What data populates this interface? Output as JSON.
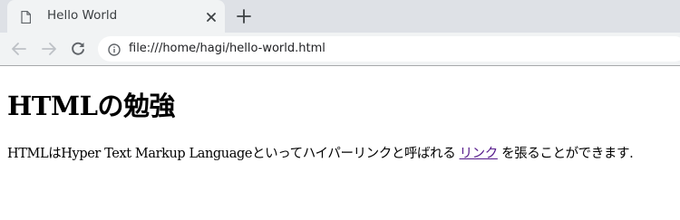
{
  "tab": {
    "title": "Hello World"
  },
  "toolbar": {
    "url": "file:///home/hagi/hello-world.html"
  },
  "page": {
    "heading": "HTMLの勉強",
    "paragraph_before": "HTMLはHyper Text Markup Languageといってハイパーリンクと呼ばれる ",
    "link_text": "リンク",
    "paragraph_after": " を張ることができます."
  },
  "colors": {
    "tabstrip_bg": "#dee1e6",
    "toolbar_bg": "#f1f3f4",
    "link_visited": "#551a8b",
    "text": "#000000"
  },
  "icons": {
    "tab": [
      "document-icon",
      "close-icon",
      "plus-icon"
    ],
    "toolbar": [
      "arrow-left-icon",
      "arrow-right-icon",
      "reload-icon",
      "info-icon"
    ]
  }
}
